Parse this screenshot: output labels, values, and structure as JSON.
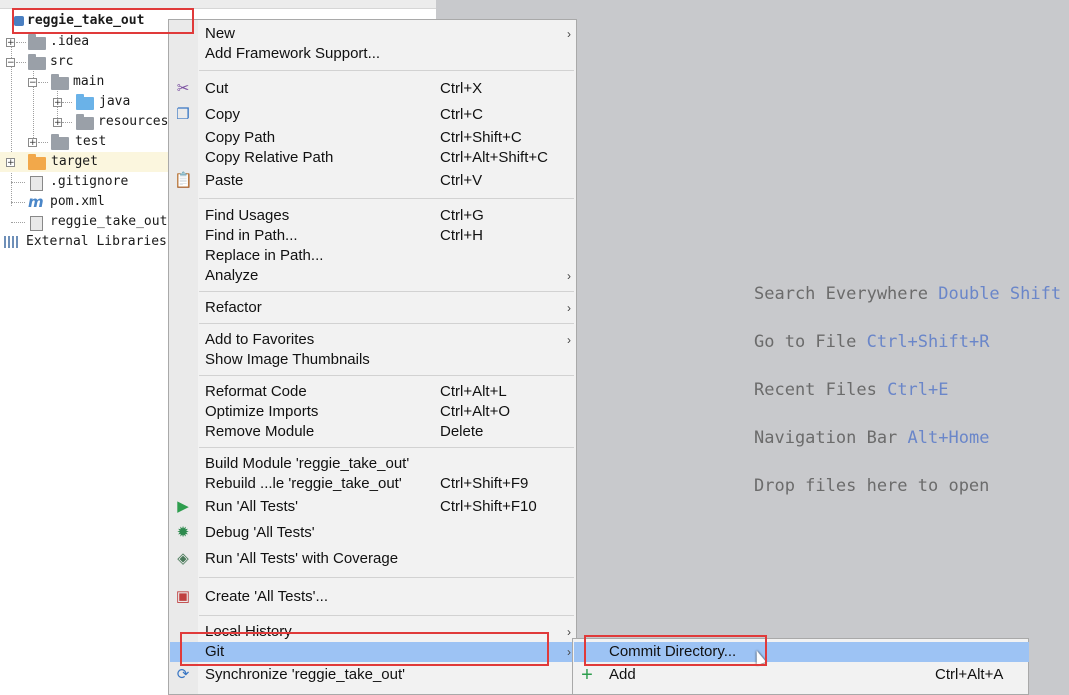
{
  "editor": {
    "hints": [
      {
        "text": "Search Everywhere",
        "key": "Double Shift"
      },
      {
        "text": "Go to File",
        "key": "Ctrl+Shift+R"
      },
      {
        "text": "Recent Files",
        "key": "Ctrl+E"
      },
      {
        "text": "Navigation Bar",
        "key": "Alt+Home"
      },
      {
        "text": "Drop files here to open",
        "key": ""
      }
    ]
  },
  "tree": {
    "root": "reggie_take_out",
    "items": [
      {
        "label": ".idea",
        "icon": "folder-icon"
      },
      {
        "label": "src",
        "icon": "folder-icon"
      },
      {
        "label": "main",
        "icon": "folder-icon"
      },
      {
        "label": "java",
        "icon": "folder-blue-icon"
      },
      {
        "label": "resources",
        "icon": "resources-folder-icon"
      },
      {
        "label": "test",
        "icon": "folder-icon"
      },
      {
        "label": "target",
        "icon": "folder-orange-icon"
      },
      {
        "label": ".gitignore",
        "icon": "file-icon"
      },
      {
        "label": "pom.xml",
        "icon": "maven-icon"
      },
      {
        "label": "reggie_take_out",
        "icon": "iml-file-icon"
      },
      {
        "label": "External Libraries",
        "icon": "libraries-icon"
      }
    ]
  },
  "menu": {
    "items": [
      {
        "label": "New",
        "shortcut": "",
        "submenu": true
      },
      {
        "label": "Add Framework Support...",
        "shortcut": ""
      },
      {
        "label": "Cut",
        "shortcut": "Ctrl+X",
        "icon": "scissors-icon"
      },
      {
        "label": "Copy",
        "shortcut": "Ctrl+C",
        "icon": "copy-icon"
      },
      {
        "label": "Copy Path",
        "shortcut": "Ctrl+Shift+C"
      },
      {
        "label": "Copy Relative Path",
        "shortcut": "Ctrl+Alt+Shift+C"
      },
      {
        "label": "Paste",
        "shortcut": "Ctrl+V",
        "icon": "paste-icon"
      },
      {
        "label": "Find Usages",
        "shortcut": "Ctrl+G"
      },
      {
        "label": "Find in Path...",
        "shortcut": "Ctrl+H"
      },
      {
        "label": "Replace in Path...",
        "shortcut": ""
      },
      {
        "label": "Analyze",
        "shortcut": "",
        "submenu": true
      },
      {
        "label": "Refactor",
        "shortcut": "",
        "submenu": true
      },
      {
        "label": "Add to Favorites",
        "shortcut": "",
        "submenu": true
      },
      {
        "label": "Show Image Thumbnails",
        "shortcut": ""
      },
      {
        "label": "Reformat Code",
        "shortcut": "Ctrl+Alt+L"
      },
      {
        "label": "Optimize Imports",
        "shortcut": "Ctrl+Alt+O"
      },
      {
        "label": "Remove Module",
        "shortcut": "Delete"
      },
      {
        "label": "Build Module 'reggie_take_out'",
        "shortcut": ""
      },
      {
        "label": "Rebuild ...le 'reggie_take_out'",
        "shortcut": "Ctrl+Shift+F9"
      },
      {
        "label": "Run 'All Tests'",
        "shortcut": "Ctrl+Shift+F10",
        "icon": "run-icon"
      },
      {
        "label": "Debug 'All Tests'",
        "shortcut": "",
        "icon": "debug-icon"
      },
      {
        "label": "Run 'All Tests' with Coverage",
        "shortcut": "",
        "icon": "coverage-icon"
      },
      {
        "label": "Create 'All Tests'...",
        "shortcut": "",
        "icon": "create-test-icon"
      },
      {
        "label": "Local History",
        "shortcut": "",
        "submenu": true
      },
      {
        "label": "Git",
        "shortcut": "",
        "submenu": true,
        "selected": true
      },
      {
        "label": "Synchronize 'reggie_take_out'",
        "shortcut": "",
        "icon": "sync-icon"
      }
    ]
  },
  "submenu": {
    "items": [
      {
        "label": "Commit Directory...",
        "shortcut": "",
        "selected": true
      },
      {
        "label": "Add",
        "shortcut": "Ctrl+Alt+A",
        "icon": "plus-icon"
      }
    ]
  },
  "colors": {
    "selection": "#9dc3f4",
    "annotation": "#e03a3a",
    "hint_key": "#6a86c9"
  }
}
